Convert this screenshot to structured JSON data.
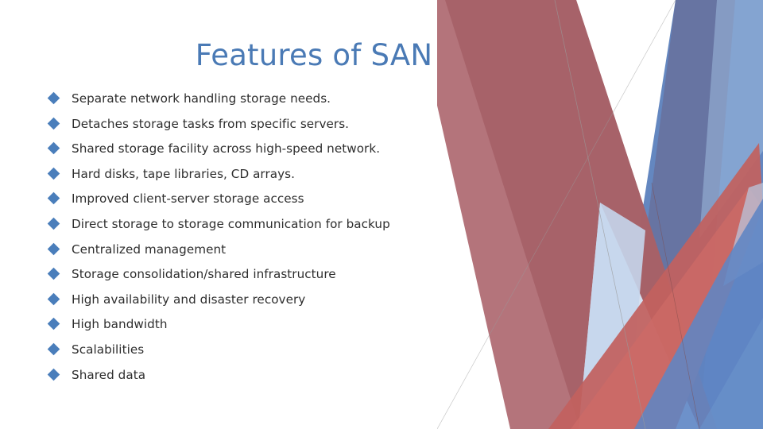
{
  "slide": {
    "title": "Features of SAN",
    "title_color": "#4a7ab5",
    "body_text_color": "#2e2e2e",
    "background_color": "#ffffff",
    "bullet_marker_color": "#4a7ebb",
    "bullet_marker_shape": "diamond-bullet-icon"
  },
  "bullets": [
    {
      "text": "Separate network handling storage needs."
    },
    {
      "text": "Detaches storage tasks from specific servers."
    },
    {
      "text": "Shared storage facility across high-speed network."
    },
    {
      "text": "Hard disks, tape libraries, CD arrays."
    },
    {
      "text": "Improved client-server storage access"
    },
    {
      "text": "Direct storage to storage communication for backup"
    },
    {
      "text": "Centralized management"
    },
    {
      "text": "Storage consolidation/shared infrastructure"
    },
    {
      "text": "High availability and disaster recovery"
    },
    {
      "text": "High bandwidth"
    },
    {
      "text": "Scalabilities"
    },
    {
      "text": "Shared data"
    }
  ],
  "decoration": {
    "name": "angled-ribbons-graphic",
    "colors": {
      "rose": "#b06d74",
      "rose_dark": "#a55f66",
      "red": "#c2615f",
      "red_bright": "#cf6b66",
      "slate_blue": "#67729f",
      "blue": "#6487c0",
      "blue_mid": "#5f85c4",
      "blue_light": "#9fbbdf",
      "pale_blue": "#d6e0f0",
      "pale_blue_2": "#c5d6ec",
      "hairline": "#9a9a9a"
    }
  }
}
